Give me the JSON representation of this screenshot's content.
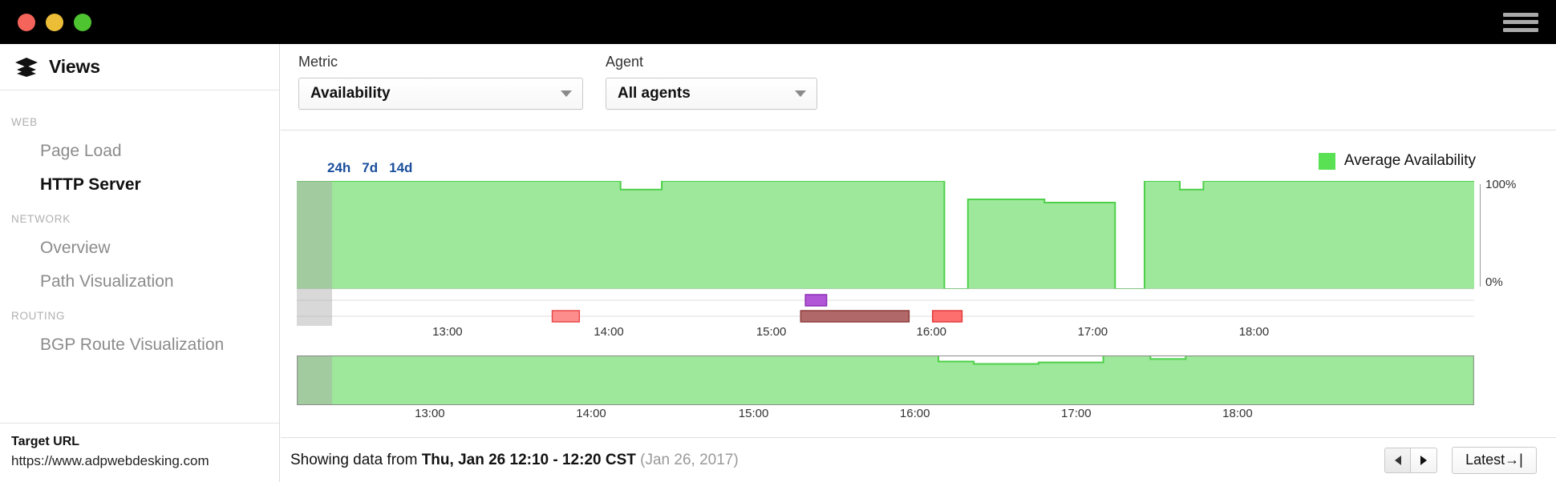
{
  "window": {
    "traffic_lights": [
      "close",
      "minimize",
      "zoom"
    ],
    "menu_icon": "hamburger-icon",
    "colors": {
      "close": "#f4645a",
      "minimize": "#ecbe38",
      "zoom": "#4ec430",
      "titlebar": "#000000"
    }
  },
  "sidebar": {
    "title": "Views",
    "title_icon": "layers-icon",
    "groups": [
      {
        "label": "WEB",
        "items": [
          {
            "label": "Page Load",
            "active": false
          },
          {
            "label": "HTTP Server",
            "active": true
          }
        ]
      },
      {
        "label": "NETWORK",
        "items": [
          {
            "label": "Overview",
            "active": false
          },
          {
            "label": "Path Visualization",
            "active": false
          }
        ]
      },
      {
        "label": "ROUTING",
        "items": [
          {
            "label": "BGP Route Visualization",
            "active": false
          }
        ]
      }
    ],
    "footer": {
      "label": "Target URL",
      "url": "https://www.adpwebdesking.com"
    }
  },
  "controls": {
    "metric": {
      "label": "Metric",
      "value": "Availability",
      "icon": "chevron-down-icon"
    },
    "agent": {
      "label": "Agent",
      "value": "All agents",
      "icon": "chevron-down-icon"
    }
  },
  "chart_panel": {
    "ranges": [
      {
        "label": "24h",
        "selected": true
      },
      {
        "label": "7d",
        "selected": false
      },
      {
        "label": "14d",
        "selected": false
      }
    ],
    "legend": {
      "swatch_color": "#5ae053",
      "label": "Average Availability"
    },
    "y_axis": {
      "top": "100%",
      "bottom": "0%"
    }
  },
  "footer": {
    "showing_prefix": "Showing data from ",
    "showing_range": "Thu, Jan 26 12:10 - 12:20 CST",
    "showing_suffix": " (Jan 26, 2017)",
    "prev_label": "◄",
    "next_label": "►",
    "latest_label": "Latest→|"
  },
  "chart_data": {
    "type": "area",
    "title": "Average Availability",
    "xlabel": "",
    "ylabel": "Availability",
    "ylim": [
      0,
      100
    ],
    "grid": false,
    "legend_position": "top-right",
    "x_tick_labels": [
      "13:00",
      "14:00",
      "15:00",
      "16:00",
      "17:00",
      "18:00"
    ],
    "x_tick_positions_pct": [
      12.8,
      26.5,
      40.3,
      53.9,
      67.6,
      81.3
    ],
    "series": [
      {
        "name": "Average Availability",
        "color": "#9de89a",
        "stroke": "#4ed04a",
        "x_pct": [
          0,
          3.0,
          3.0,
          27.5,
          27.5,
          31.0,
          31.0,
          55.0,
          55.0,
          57.0,
          57.0,
          63.5,
          63.5,
          69.5,
          69.5,
          72.0,
          72.0,
          75.0,
          75.0,
          77.0,
          77.0,
          100.0
        ],
        "values": [
          100,
          100,
          100,
          100,
          92,
          92,
          100,
          100,
          0,
          0,
          83,
          83,
          80,
          80,
          0,
          0,
          100,
          100,
          92,
          92,
          100,
          100
        ]
      }
    ],
    "selection_overlay": {
      "from_pct": 0,
      "to_pct": 3.0,
      "color": "#a8a8a8",
      "opacity": 0.45
    },
    "events": [
      {
        "lane": 1,
        "type": "alert-purple",
        "from_pct": 43.2,
        "to_pct": 45.0,
        "fill": "#b056d6",
        "stroke": "#8c2fb5"
      },
      {
        "lane": 2,
        "type": "alert-red",
        "from_pct": 21.7,
        "to_pct": 24.0,
        "fill": "#fd8c8c",
        "stroke": "#e84a4a"
      },
      {
        "lane": 2,
        "type": "alert-dark-red",
        "from_pct": 42.8,
        "to_pct": 52.0,
        "fill": "#b06868",
        "stroke": "#8f3b3b"
      },
      {
        "lane": 2,
        "type": "alert-red",
        "from_pct": 54.0,
        "to_pct": 56.5,
        "fill": "#fd6f6f",
        "stroke": "#e43c3c"
      }
    ],
    "overview": {
      "x_tick_labels": [
        "13:00",
        "14:00",
        "15:00",
        "16:00",
        "17:00",
        "18:00"
      ],
      "x_tick_positions_pct": [
        11.3,
        25.0,
        38.8,
        52.5,
        66.2,
        79.9
      ],
      "color": "#9de89a",
      "stroke": "#4ed04a",
      "x_pct": [
        0,
        3.0,
        3.0,
        26.5,
        26.5,
        54.5,
        54.5,
        57.5,
        57.5,
        63.0,
        63.0,
        68.5,
        68.5,
        72.5,
        72.5,
        75.5,
        75.5,
        100.0
      ],
      "values": [
        100,
        100,
        100,
        100,
        100,
        100,
        88,
        88,
        83,
        83,
        86,
        86,
        100,
        100,
        93,
        93,
        100,
        100
      ],
      "selection_from_pct": 0,
      "selection_to_pct": 3.0
    }
  }
}
